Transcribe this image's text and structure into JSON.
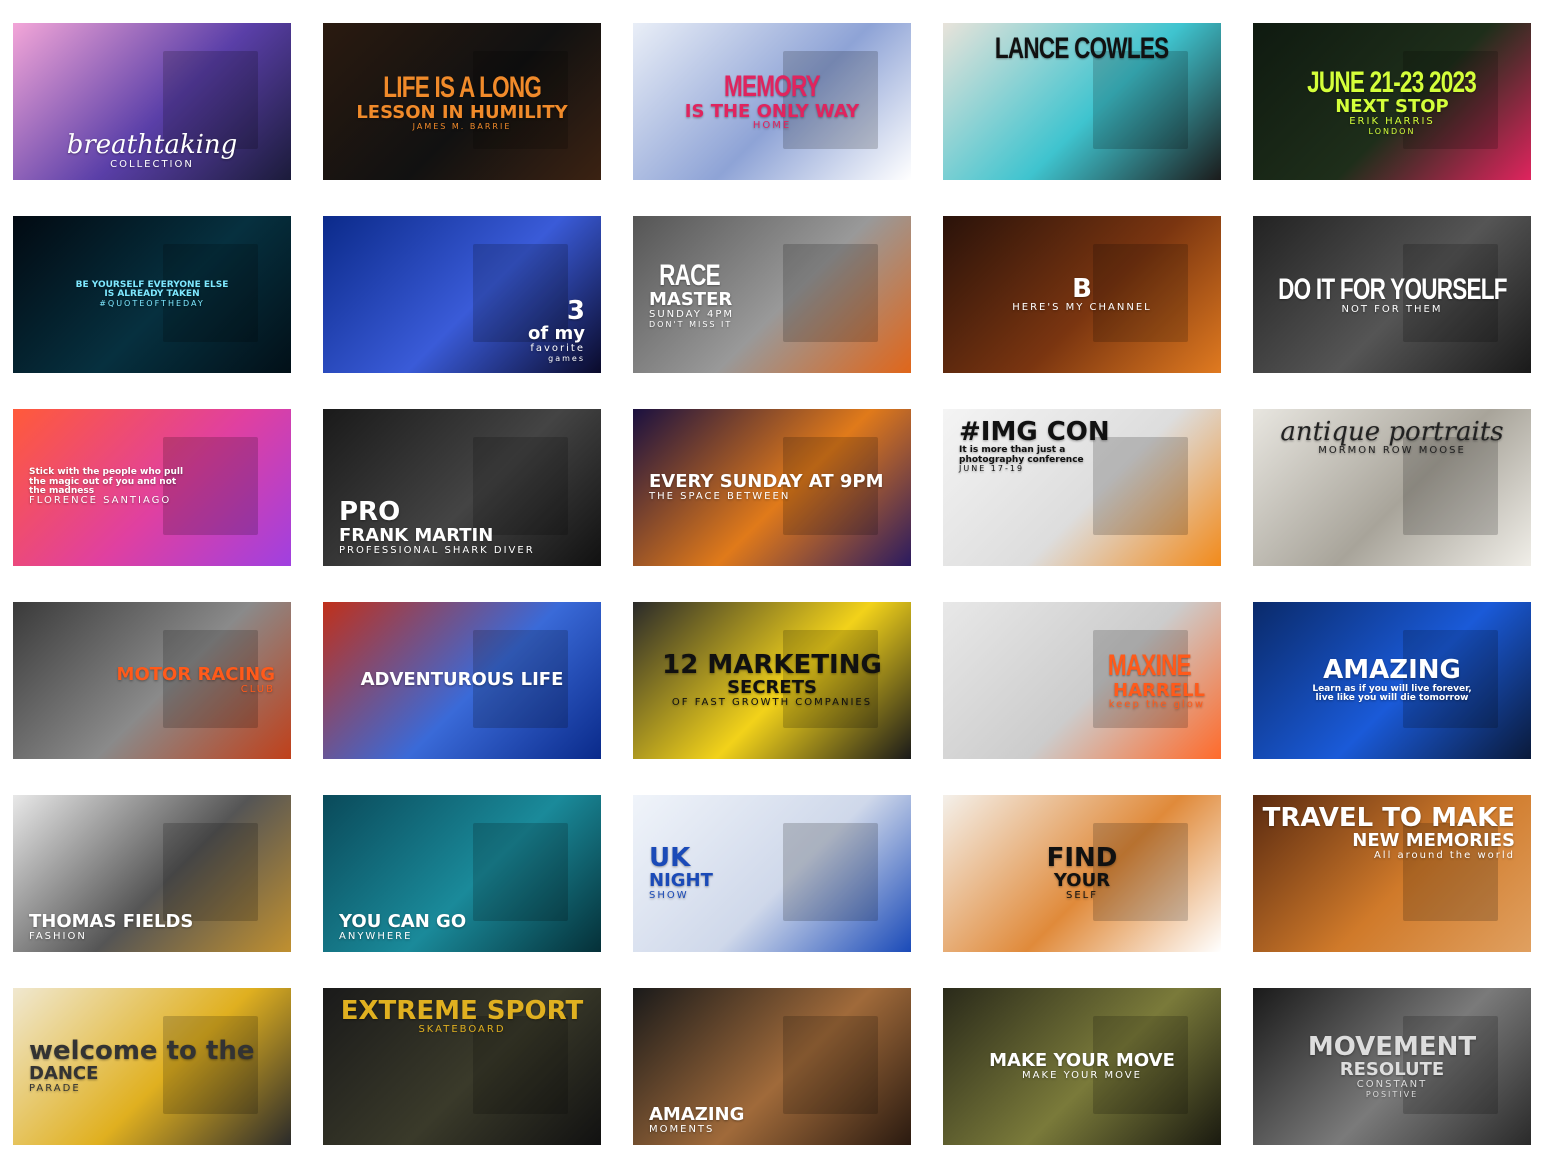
{
  "tiles": [
    {
      "name": "breathtaking-collection",
      "bg": [
        "#f3a6d8",
        "#5a3fa8",
        "#1b1b3a"
      ],
      "fg": "#ffffff",
      "lines": [
        "breathtaking",
        "",
        "COLLECTION"
      ]
    },
    {
      "name": "life-is-a-long-lesson",
      "bg": [
        "#2a1a10",
        "#111111",
        "#3b2212"
      ],
      "fg": "#f08a2a",
      "lines": [
        "LIFE IS A LONG",
        "LESSON IN HUMILITY",
        "",
        "JAMES M. BARRIE"
      ]
    },
    {
      "name": "memory-is-the-only-way-home",
      "bg": [
        "#e9eef7",
        "#8ea3d6",
        "#ffffff"
      ],
      "fg": "#e0245e",
      "lines": [
        "MEMORY",
        "IS THE ONLY WAY",
        "HOME"
      ]
    },
    {
      "name": "lance-cowles",
      "bg": [
        "#e8e3da",
        "#3fc4cf",
        "#1b1b1b"
      ],
      "fg": "#111111",
      "lines": [
        "LANCE COWLES"
      ]
    },
    {
      "name": "next-stop-london",
      "bg": [
        "#0f1a10",
        "#1e2e1a",
        "#e0245e"
      ],
      "fg": "#d4ff3a",
      "lines": [
        "JUNE 21-23 2023",
        "NEXT STOP",
        "ERIK HARRIS",
        "LONDON"
      ]
    },
    {
      "name": "be-yourself-quote",
      "bg": [
        "#020a12",
        "#06303f",
        "#021018"
      ],
      "fg": "#7ee8ff",
      "lines": [
        "",
        "",
        "BE YOURSELF EVERYONE ELSE IS ALREADY TAKEN",
        "#QUOTEOFTHEDAY"
      ]
    },
    {
      "name": "3-favorite-games",
      "bg": [
        "#0b2a8a",
        "#3a5bd8",
        "#0a0a2a"
      ],
      "fg": "#ffffff",
      "lines": [
        "3",
        "of my",
        "favorite",
        "games"
      ]
    },
    {
      "name": "race-master",
      "bg": [
        "#555555",
        "#999999",
        "#e0661a"
      ],
      "fg": "#ffffff",
      "lines": [
        "RACE",
        "MASTER",
        "SUNDAY 4PM",
        "DON'T MISS IT"
      ]
    },
    {
      "name": "heres-my-channel",
      "bg": [
        "#2a120a",
        "#7a3510",
        "#e07a20"
      ],
      "fg": "#ffffff",
      "lines": [
        "B",
        "",
        "HERE'S MY CHANNEL"
      ]
    },
    {
      "name": "do-it-for-yourself",
      "bg": [
        "#222222",
        "#555555",
        "#1a1a1a"
      ],
      "fg": "#ffffff",
      "lines": [
        "DO IT FOR YOURSELF",
        "",
        "NOT FOR THEM"
      ]
    },
    {
      "name": "stick-with-the-people-quote",
      "bg": [
        "#ff5a3a",
        "#e040a0",
        "#a040e0"
      ],
      "fg": "#ffffff",
      "lines": [
        "",
        "Stick with the people who pull the magic out of you and not the madness",
        "FLORENCE SANTIAGO"
      ]
    },
    {
      "name": "frank-martin",
      "bg": [
        "#1a1a1a",
        "#444444",
        "#111111"
      ],
      "fg": "#ffffff",
      "lines": [
        "PRO",
        "FRANK MARTIN",
        "PROFESSIONAL SHARK DIVER"
      ]
    },
    {
      "name": "every-sunday-at-9pm",
      "bg": [
        "#1a1040",
        "#e07a1a",
        "#2a1a60"
      ],
      "fg": "#ffffff",
      "lines": [
        "",
        "EVERY SUNDAY AT 9PM",
        "THE SPACE BETWEEN"
      ]
    },
    {
      "name": "img-con",
      "bg": [
        "#f4f4f4",
        "#dddddd",
        "#f28a1a"
      ],
      "fg": "#111111",
      "lines": [
        "#IMG CON",
        "",
        "It is more than just a photography conference",
        "JUNE 17-19"
      ]
    },
    {
      "name": "antique-portraits",
      "bg": [
        "#e8e6e0",
        "#a8a49a",
        "#f0eee8"
      ],
      "fg": "#222222",
      "lines": [
        "antique portraits",
        "",
        "MORMON ROW MOOSE"
      ]
    },
    {
      "name": "motor-racing-club",
      "bg": [
        "#3a3a3a",
        "#8a8a8a",
        "#c0401a"
      ],
      "fg": "#ff5a1a",
      "lines": [
        "",
        "MOTOR RACING",
        "CLUB"
      ]
    },
    {
      "name": "adventurous-life",
      "bg": [
        "#c0301a",
        "#3a6ad8",
        "#0a2a8a"
      ],
      "fg": "#ffffff",
      "lines": [
        "",
        "ADVENTUROUS LIFE"
      ]
    },
    {
      "name": "12-marketing-secrets",
      "bg": [
        "#2a2a2a",
        "#f2d21a",
        "#1a1a1a"
      ],
      "fg": "#111111",
      "lines": [
        "12 MARKETING",
        "SECRETS",
        "OF FAST GROWTH COMPANIES"
      ]
    },
    {
      "name": "maxine-harrell",
      "bg": [
        "#e8e8e8",
        "#cccccc",
        "#ff6a2a"
      ],
      "fg": "#ff5a1a",
      "lines": [
        "MAXINE",
        "HARRELL",
        "keep the glow"
      ]
    },
    {
      "name": "amazing",
      "bg": [
        "#0a2a6a",
        "#1a5ad8",
        "#0a1a3a"
      ],
      "fg": "#ffffff",
      "lines": [
        "AMAZING",
        "Learn as if you will live forever, live like you will die tomorrow"
      ]
    },
    {
      "name": "thomas-fields",
      "bg": [
        "#e8e8e8",
        "#555555",
        "#c09030"
      ],
      "fg": "#ffffff",
      "lines": [
        "",
        "THOMAS FIELDS",
        "FASHION"
      ]
    },
    {
      "name": "you-can-go-anywhere",
      "bg": [
        "#0a4a5a",
        "#1a8a9a",
        "#053038"
      ],
      "fg": "#ffffff",
      "lines": [
        "",
        "YOU CAN GO",
        "ANYWHERE"
      ]
    },
    {
      "name": "uk-night-show",
      "bg": [
        "#f0f4fa",
        "#cfd8ea",
        "#1a4ab8"
      ],
      "fg": "#1a4ab8",
      "lines": [
        "UK",
        "NIGHT",
        "SHOW"
      ]
    },
    {
      "name": "find-your-self",
      "bg": [
        "#f4f0ea",
        "#e08a3a",
        "#ffffff"
      ],
      "fg": "#111111",
      "lines": [
        "FIND",
        "YOUR",
        "SELF"
      ]
    },
    {
      "name": "travel-to-make-new-memories",
      "bg": [
        "#5a2a10",
        "#d07a2a",
        "#e0a060"
      ],
      "fg": "#ffffff",
      "lines": [
        "TRAVEL TO MAKE",
        "NEW MEMORIES",
        "All around the world"
      ]
    },
    {
      "name": "dance-parade",
      "bg": [
        "#f0e8d0",
        "#e0b020",
        "#2a2a2a"
      ],
      "fg": "#333333",
      "lines": [
        "welcome to the",
        "DANCE",
        "PARADE"
      ]
    },
    {
      "name": "extreme-sport",
      "bg": [
        "#1a1a1a",
        "#3a3a2a",
        "#111111"
      ],
      "fg": "#e0b020",
      "lines": [
        "EXTREME SPORT",
        "",
        "SKATEBOARD"
      ]
    },
    {
      "name": "amazing-moments",
      "bg": [
        "#1a1a1a",
        "#a06a3a",
        "#2a1a10"
      ],
      "fg": "#ffffff",
      "lines": [
        "",
        "AMAZING",
        "MOMENTS"
      ]
    },
    {
      "name": "make-your-move",
      "bg": [
        "#2a2a1a",
        "#7a7a3a",
        "#1a1a10"
      ],
      "fg": "#ffffff",
      "lines": [
        "",
        "MAKE YOUR MOVE",
        "MAKE YOUR MOVE"
      ]
    },
    {
      "name": "movement-resolute-constant-positive",
      "bg": [
        "#1a1a1a",
        "#7a7a7a",
        "#2a2a2a"
      ],
      "fg": "#dddddd",
      "lines": [
        "MOVEMENT",
        "RESOLUTE",
        "CONSTANT",
        "POSITIVE"
      ]
    }
  ]
}
